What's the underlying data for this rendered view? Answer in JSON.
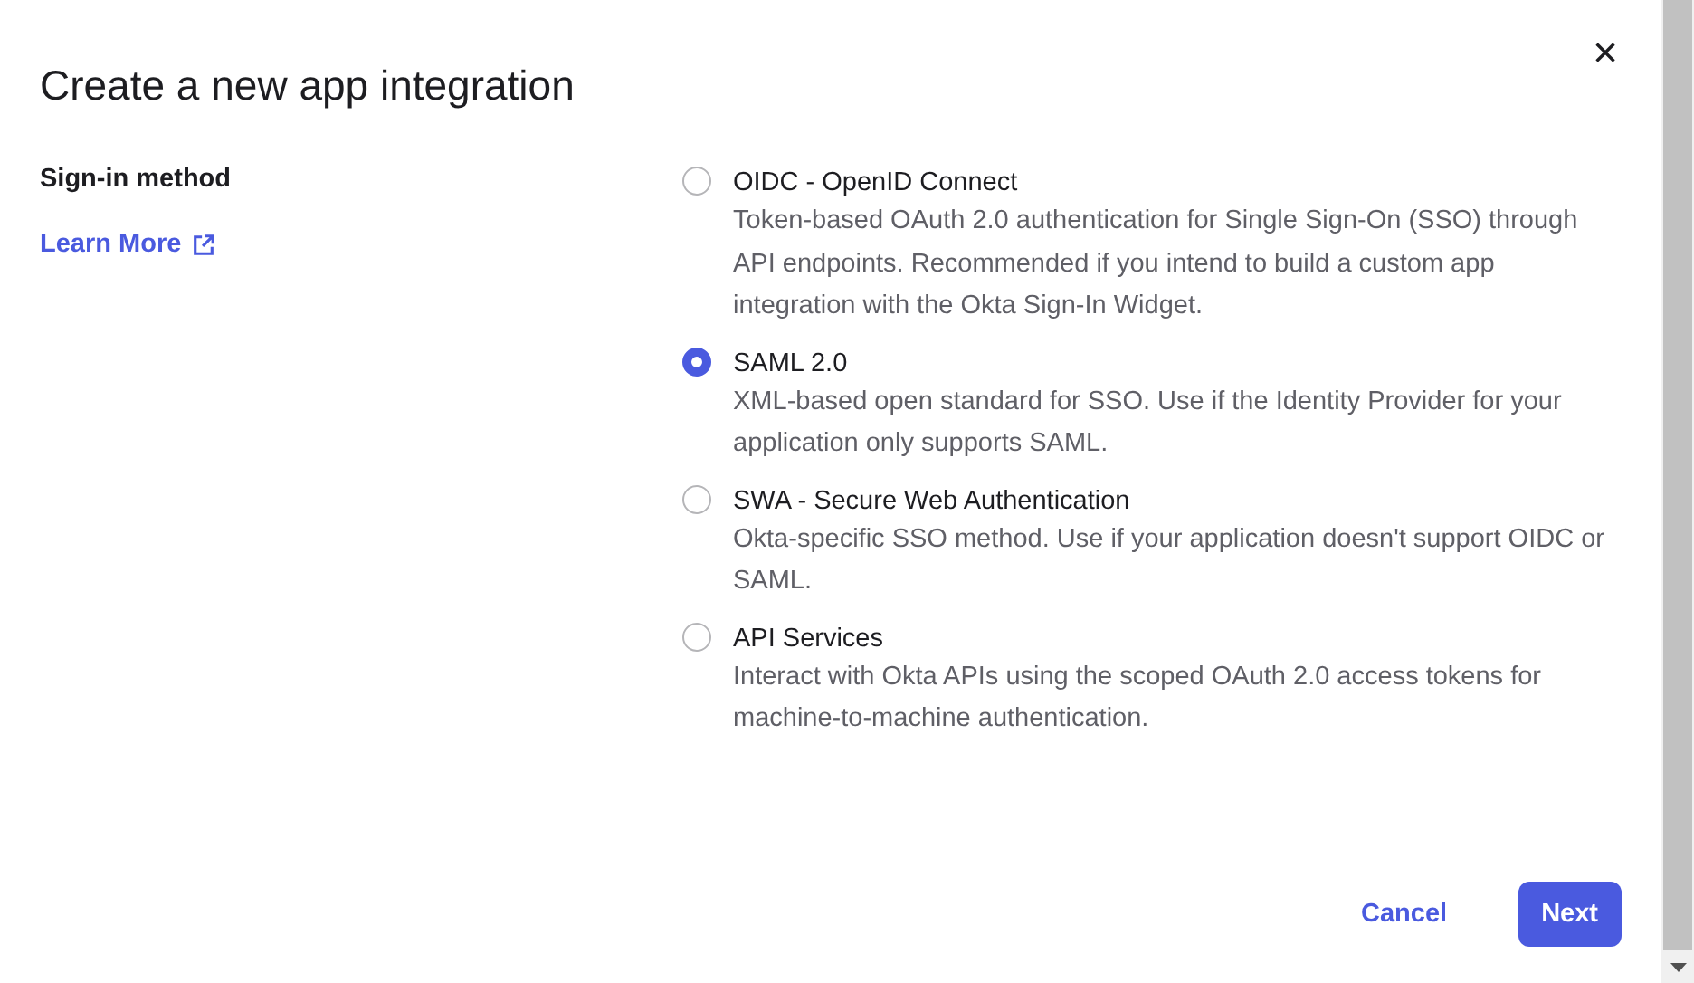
{
  "dialog": {
    "title": "Create a new app integration",
    "close": "×"
  },
  "field": {
    "label": "Sign-in method",
    "link": "Learn More"
  },
  "options": [
    {
      "label": "OIDC - OpenID Connect",
      "description": "Token-based OAuth 2.0 authentication for Single Sign-On (SSO) through API endpoints. Recommended if you intend to build a custom app integration with the Okta Sign-In Widget.",
      "selected": false
    },
    {
      "label": "SAML 2.0",
      "description": "XML-based open standard for SSO. Use if the Identity Provider for your application only supports SAML.",
      "selected": true
    },
    {
      "label": "SWA - Secure Web Authentication",
      "description": "Okta-specific SSO method. Use if your application doesn't support OIDC or SAML.",
      "selected": false
    },
    {
      "label": "API Services",
      "description": "Interact with Okta APIs using the scoped OAuth 2.0 access tokens for machine-to-machine authentication.",
      "selected": false
    }
  ],
  "buttons": [
    {
      "label": "Cancel",
      "kind": "secondary"
    },
    {
      "label": "Next",
      "kind": "primary"
    }
  ]
}
